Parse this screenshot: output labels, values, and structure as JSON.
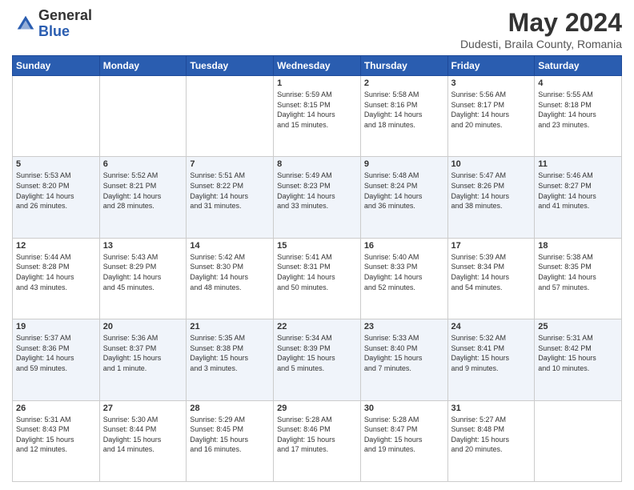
{
  "header": {
    "logo_general": "General",
    "logo_blue": "Blue",
    "month_title": "May 2024",
    "subtitle": "Dudesti, Braila County, Romania"
  },
  "weekdays": [
    "Sunday",
    "Monday",
    "Tuesday",
    "Wednesday",
    "Thursday",
    "Friday",
    "Saturday"
  ],
  "weeks": [
    [
      {
        "day": "",
        "info": ""
      },
      {
        "day": "",
        "info": ""
      },
      {
        "day": "",
        "info": ""
      },
      {
        "day": "1",
        "info": "Sunrise: 5:59 AM\nSunset: 8:15 PM\nDaylight: 14 hours\nand 15 minutes."
      },
      {
        "day": "2",
        "info": "Sunrise: 5:58 AM\nSunset: 8:16 PM\nDaylight: 14 hours\nand 18 minutes."
      },
      {
        "day": "3",
        "info": "Sunrise: 5:56 AM\nSunset: 8:17 PM\nDaylight: 14 hours\nand 20 minutes."
      },
      {
        "day": "4",
        "info": "Sunrise: 5:55 AM\nSunset: 8:18 PM\nDaylight: 14 hours\nand 23 minutes."
      }
    ],
    [
      {
        "day": "5",
        "info": "Sunrise: 5:53 AM\nSunset: 8:20 PM\nDaylight: 14 hours\nand 26 minutes."
      },
      {
        "day": "6",
        "info": "Sunrise: 5:52 AM\nSunset: 8:21 PM\nDaylight: 14 hours\nand 28 minutes."
      },
      {
        "day": "7",
        "info": "Sunrise: 5:51 AM\nSunset: 8:22 PM\nDaylight: 14 hours\nand 31 minutes."
      },
      {
        "day": "8",
        "info": "Sunrise: 5:49 AM\nSunset: 8:23 PM\nDaylight: 14 hours\nand 33 minutes."
      },
      {
        "day": "9",
        "info": "Sunrise: 5:48 AM\nSunset: 8:24 PM\nDaylight: 14 hours\nand 36 minutes."
      },
      {
        "day": "10",
        "info": "Sunrise: 5:47 AM\nSunset: 8:26 PM\nDaylight: 14 hours\nand 38 minutes."
      },
      {
        "day": "11",
        "info": "Sunrise: 5:46 AM\nSunset: 8:27 PM\nDaylight: 14 hours\nand 41 minutes."
      }
    ],
    [
      {
        "day": "12",
        "info": "Sunrise: 5:44 AM\nSunset: 8:28 PM\nDaylight: 14 hours\nand 43 minutes."
      },
      {
        "day": "13",
        "info": "Sunrise: 5:43 AM\nSunset: 8:29 PM\nDaylight: 14 hours\nand 45 minutes."
      },
      {
        "day": "14",
        "info": "Sunrise: 5:42 AM\nSunset: 8:30 PM\nDaylight: 14 hours\nand 48 minutes."
      },
      {
        "day": "15",
        "info": "Sunrise: 5:41 AM\nSunset: 8:31 PM\nDaylight: 14 hours\nand 50 minutes."
      },
      {
        "day": "16",
        "info": "Sunrise: 5:40 AM\nSunset: 8:33 PM\nDaylight: 14 hours\nand 52 minutes."
      },
      {
        "day": "17",
        "info": "Sunrise: 5:39 AM\nSunset: 8:34 PM\nDaylight: 14 hours\nand 54 minutes."
      },
      {
        "day": "18",
        "info": "Sunrise: 5:38 AM\nSunset: 8:35 PM\nDaylight: 14 hours\nand 57 minutes."
      }
    ],
    [
      {
        "day": "19",
        "info": "Sunrise: 5:37 AM\nSunset: 8:36 PM\nDaylight: 14 hours\nand 59 minutes."
      },
      {
        "day": "20",
        "info": "Sunrise: 5:36 AM\nSunset: 8:37 PM\nDaylight: 15 hours\nand 1 minute."
      },
      {
        "day": "21",
        "info": "Sunrise: 5:35 AM\nSunset: 8:38 PM\nDaylight: 15 hours\nand 3 minutes."
      },
      {
        "day": "22",
        "info": "Sunrise: 5:34 AM\nSunset: 8:39 PM\nDaylight: 15 hours\nand 5 minutes."
      },
      {
        "day": "23",
        "info": "Sunrise: 5:33 AM\nSunset: 8:40 PM\nDaylight: 15 hours\nand 7 minutes."
      },
      {
        "day": "24",
        "info": "Sunrise: 5:32 AM\nSunset: 8:41 PM\nDaylight: 15 hours\nand 9 minutes."
      },
      {
        "day": "25",
        "info": "Sunrise: 5:31 AM\nSunset: 8:42 PM\nDaylight: 15 hours\nand 10 minutes."
      }
    ],
    [
      {
        "day": "26",
        "info": "Sunrise: 5:31 AM\nSunset: 8:43 PM\nDaylight: 15 hours\nand 12 minutes."
      },
      {
        "day": "27",
        "info": "Sunrise: 5:30 AM\nSunset: 8:44 PM\nDaylight: 15 hours\nand 14 minutes."
      },
      {
        "day": "28",
        "info": "Sunrise: 5:29 AM\nSunset: 8:45 PM\nDaylight: 15 hours\nand 16 minutes."
      },
      {
        "day": "29",
        "info": "Sunrise: 5:28 AM\nSunset: 8:46 PM\nDaylight: 15 hours\nand 17 minutes."
      },
      {
        "day": "30",
        "info": "Sunrise: 5:28 AM\nSunset: 8:47 PM\nDaylight: 15 hours\nand 19 minutes."
      },
      {
        "day": "31",
        "info": "Sunrise: 5:27 AM\nSunset: 8:48 PM\nDaylight: 15 hours\nand 20 minutes."
      },
      {
        "day": "",
        "info": ""
      }
    ]
  ]
}
